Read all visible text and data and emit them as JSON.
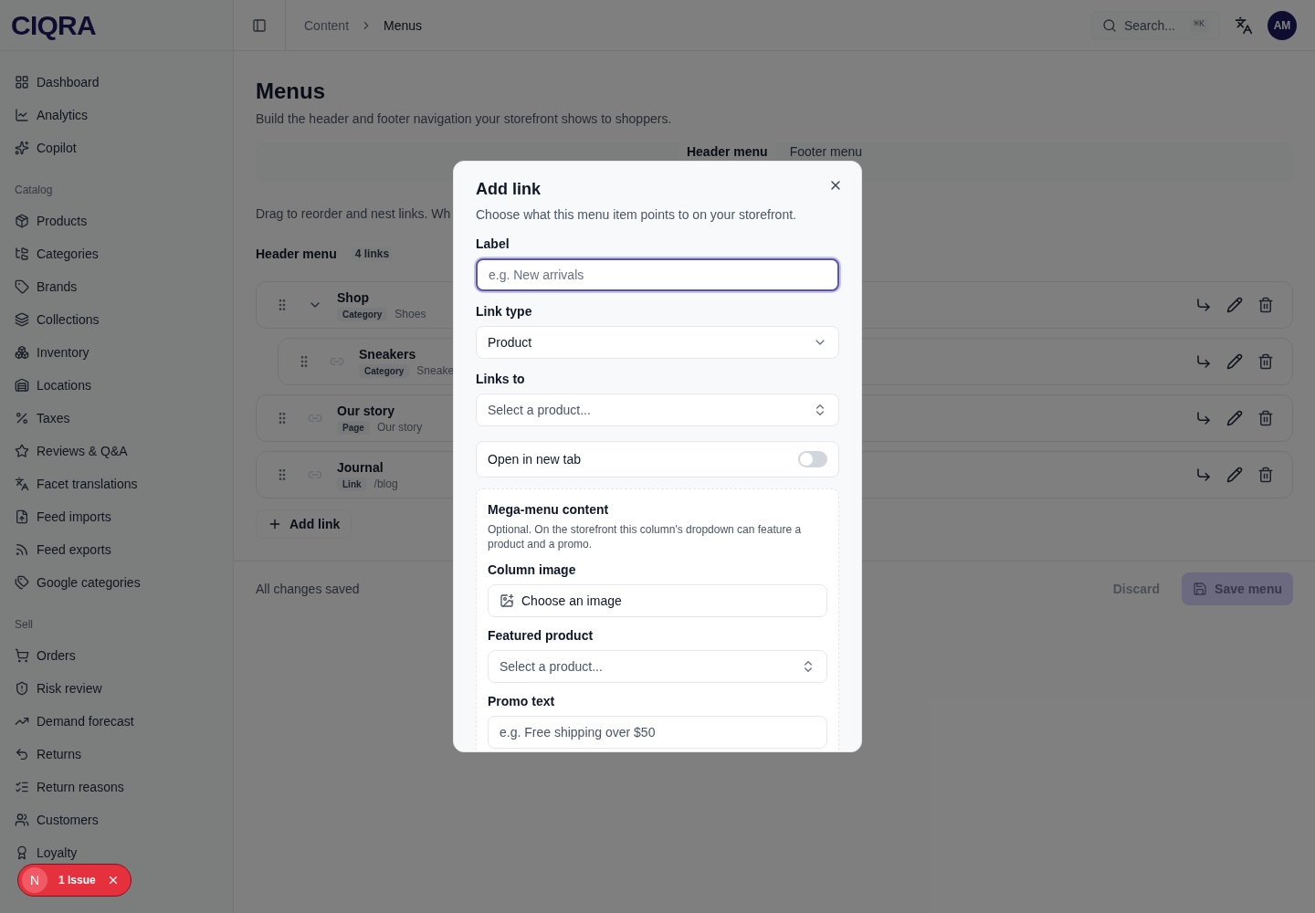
{
  "brand": "CIQRA",
  "sidebar": {
    "sections": [
      {
        "items": [
          {
            "label": "Dashboard"
          },
          {
            "label": "Analytics"
          },
          {
            "label": "Copilot"
          }
        ]
      },
      {
        "title": "Catalog",
        "items": [
          {
            "label": "Products"
          },
          {
            "label": "Categories"
          },
          {
            "label": "Brands"
          },
          {
            "label": "Collections"
          },
          {
            "label": "Inventory"
          },
          {
            "label": "Locations"
          },
          {
            "label": "Taxes"
          },
          {
            "label": "Reviews & Q&A"
          },
          {
            "label": "Facet translations"
          },
          {
            "label": "Feed imports"
          },
          {
            "label": "Feed exports"
          },
          {
            "label": "Google categories"
          }
        ]
      },
      {
        "title": "Sell",
        "items": [
          {
            "label": "Orders"
          },
          {
            "label": "Risk review"
          },
          {
            "label": "Demand forecast"
          },
          {
            "label": "Returns"
          },
          {
            "label": "Return reasons"
          },
          {
            "label": "Customers"
          },
          {
            "label": "Loyalty"
          }
        ]
      }
    ]
  },
  "issue_badge": {
    "letter": "N",
    "text": "1 Issue"
  },
  "breadcrumb": [
    "Content",
    "Menus"
  ],
  "search": {
    "placeholder": "Search...",
    "shortcut": "⌘K"
  },
  "avatar": "AM",
  "page": {
    "title": "Menus",
    "subtitle": "Build the header and footer navigation your storefront shows to shoppers.",
    "tabs": [
      {
        "label": "Header menu",
        "selected": true
      },
      {
        "label": "Footer menu",
        "selected": false
      }
    ],
    "hint": "Drag to reorder and nest links. Wh",
    "menu_title": "Header menu",
    "menu_count": "4 links",
    "items": [
      {
        "title": "Shop",
        "type": "Category",
        "target": "Shoes",
        "expanded": true,
        "children": [
          {
            "title": "Sneakers",
            "type": "Category",
            "target": "Sneake"
          }
        ]
      },
      {
        "title": "Our story",
        "type": "Page",
        "target": "Our story"
      },
      {
        "title": "Journal",
        "type": "Link",
        "target": "/blog"
      }
    ],
    "add_button": "Add link",
    "status": "All changes saved",
    "discard": "Discard",
    "save": "Save menu"
  },
  "dialog": {
    "title": "Add link",
    "description": "Choose what this menu item points to on your storefront.",
    "label_field": {
      "label": "Label",
      "placeholder": "e.g. New arrivals"
    },
    "link_type": {
      "label": "Link type",
      "value": "Product"
    },
    "links_to": {
      "label": "Links to",
      "placeholder": "Select a product..."
    },
    "new_tab": {
      "label": "Open in new tab",
      "on": false
    },
    "mega": {
      "title": "Mega-menu content",
      "description": "Optional. On the storefront this column's dropdown can feature a product and a promo.",
      "image": {
        "label": "Column image",
        "button": "Choose an image"
      },
      "product": {
        "label": "Featured product",
        "placeholder": "Select a product..."
      },
      "promo": {
        "label": "Promo text",
        "placeholder": "e.g. Free shipping over $50"
      }
    }
  }
}
